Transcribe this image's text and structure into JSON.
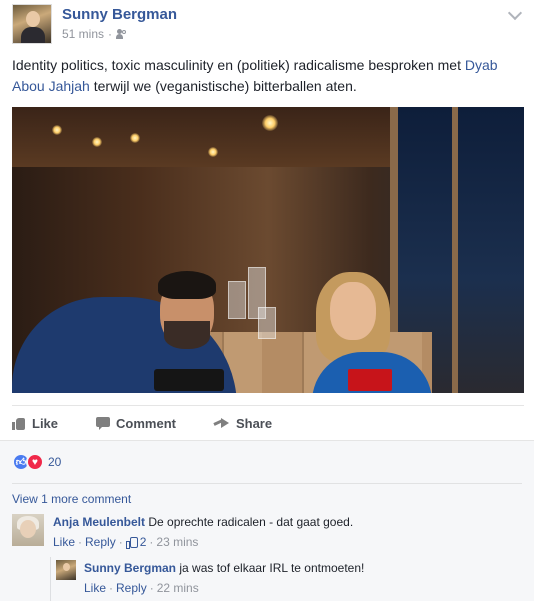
{
  "post": {
    "author": "Sunny Bergman",
    "time": "51 mins",
    "privacy_icon": "friends-icon",
    "text_before": "Identity politics, toxic masculinity en (politiek) radicalisme besproken met ",
    "mention": "Dyab Abou Jahjah",
    "text_after": " terwijl we (veganistische) bitterballen aten."
  },
  "actions": {
    "like": "Like",
    "comment": "Comment",
    "share": "Share"
  },
  "reactions": {
    "count": "20",
    "types": [
      "like",
      "love"
    ]
  },
  "comments": {
    "view_more": "View 1 more comment",
    "items": [
      {
        "author": "Anja Meulenbelt",
        "text": "De oprechte radicalen - dat gaat goed.",
        "like_label": "Like",
        "reply_label": "Reply",
        "like_count": "2",
        "time": "23 mins"
      }
    ],
    "replies": [
      {
        "author": "Sunny Bergman",
        "text": "ja was tof elkaar IRL te ontmoeten!",
        "like_label": "Like",
        "reply_label": "Reply",
        "time": "22 mins"
      }
    ]
  },
  "colors": {
    "link": "#365899",
    "muted": "#90949c",
    "like_reaction": "#4a7bf0",
    "love_reaction": "#f0284a"
  }
}
